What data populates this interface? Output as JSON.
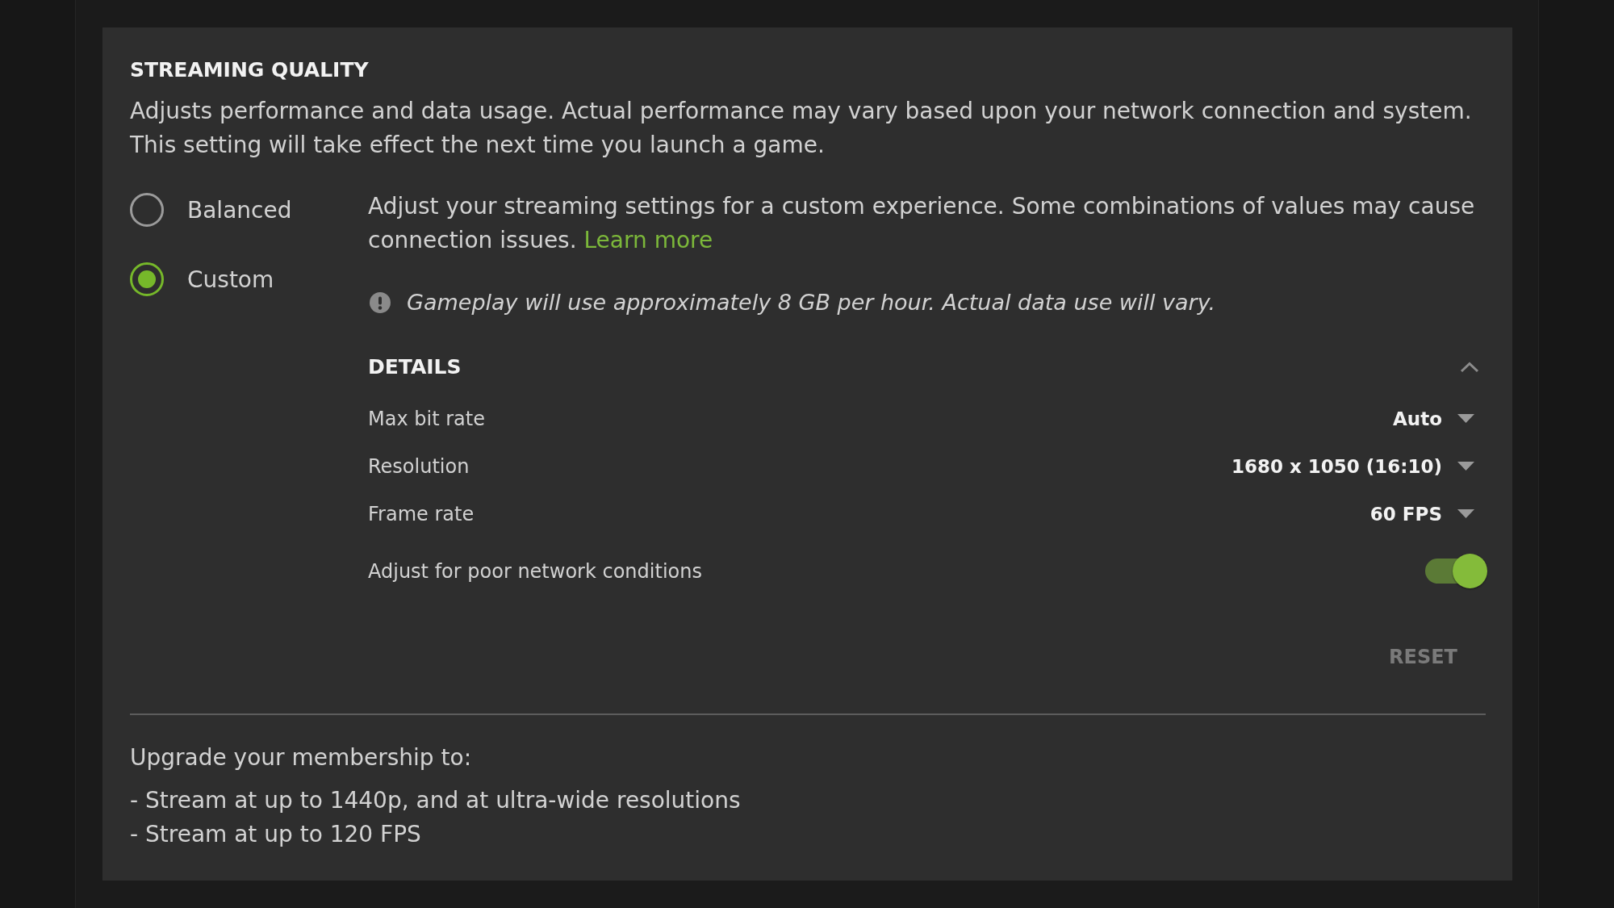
{
  "section": {
    "title": "STREAMING QUALITY",
    "description_lines": [
      "Adjusts performance and data usage. Actual performance may vary based upon your network connection and system.",
      "This setting will take effect the next time you launch a game."
    ]
  },
  "options": [
    {
      "label": "Balanced",
      "selected": false
    },
    {
      "label": "Custom",
      "selected": true
    }
  ],
  "custom_settings": {
    "description": "Adjust your streaming settings for a custom experience. Some combinations of values may cause connection issues.",
    "link": "Learn more",
    "note": "Gameplay will use approximately 8 GB per hour. Actual data use will vary.",
    "details": {
      "title": "DETAILS",
      "expanded": true,
      "settings": [
        {
          "kind": "dropdown",
          "label": "Max bit rate",
          "value": "Auto"
        },
        {
          "kind": "dropdown",
          "label": "Resolution",
          "value": "1680 x 1050 (16:10)"
        },
        {
          "kind": "dropdown",
          "label": "Frame rate",
          "value": "60 FPS"
        },
        {
          "kind": "toggle",
          "label": "Adjust for poor network conditions",
          "on": true
        }
      ]
    },
    "reset": {
      "label": "RESET",
      "disabled": true
    }
  },
  "upgrade": {
    "heading": "Upgrade your membership to:",
    "items": [
      "- Stream at up to 1440p, and at ultra-wide resolutions",
      "- Stream at up to 120 FPS"
    ]
  }
}
